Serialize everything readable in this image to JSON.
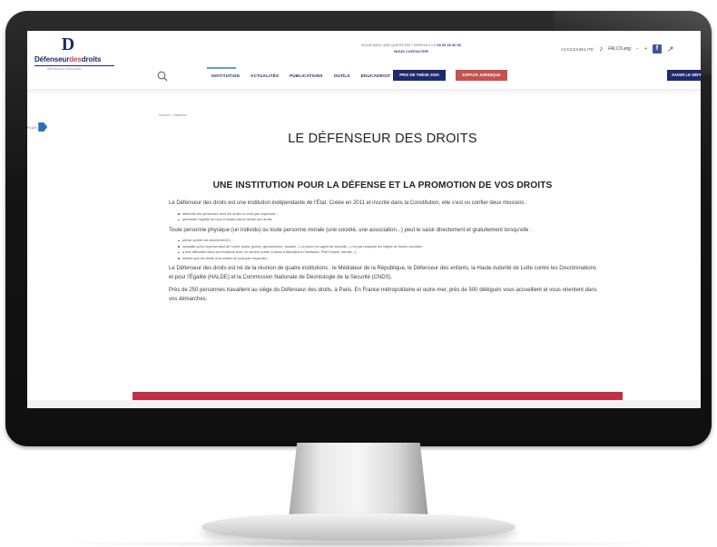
{
  "header": {
    "logo_letter": "D",
    "logo_part1": "Défenseur",
    "logo_part2": "des",
    "logo_part3": "droits",
    "logo_tagline": "RÉPUBLIQUE FRANÇAISE",
    "notice_line1": "VOUS AVEZ UNE QUESTION ? APPELEZ LE",
    "notice_number": "09 69 39 00 00",
    "notice_line2": "NOUS CONTACTER",
    "accessibility_label": "ACCESSIBILITÉ",
    "lang_label": "FALC/Lang",
    "facebook_glyph": "f"
  },
  "nav": {
    "items": [
      "INSTITUTION",
      "ACTUALITÉS",
      "PUBLICATIONS",
      "OUTILS",
      "EDUCADROIT"
    ],
    "prix_button": "PRIX DE THÈSE 2020",
    "espace_button": "ESPACE JURIDIQUE",
    "saisir_button": "SAISIR LE DÉFENSEUR"
  },
  "side_tab": {
    "label": "FLUX"
  },
  "main": {
    "breadcrumb": "Accueil > Institution",
    "page_title": "LE DÉFENSEUR DES DROITS",
    "section_title": "UNE INSTITUTION POUR LA DÉFENSE ET LA PROMOTION DE VOS DROITS",
    "p1": "Le Défenseur des droits est une institution indépendante de l'État. Créée en 2011 et inscrite dans la Constitution, elle s'est vu confier deux missions :",
    "bullets1": [
      "défendre les personnes dont les droits ne sont pas respectés ;",
      "permettre l'égalité de tous et toutes dans l'accès aux droits."
    ],
    "p2": "Toute personne physique (un individu) ou toute personne morale (une société, une association...) peut le saisir directement et gratuitement lorsqu'elle :",
    "bullet2_1_text": "pense qu'elle est discriminée",
    "bullet2_1_link": "(1)",
    "bullets2_rest": [
      "constate qu'un représentant de l'ordre public (police, gendarmerie, douane...) ou privé (un agent de sécurité...) n'a pas respecté les règles de bonne conduite ;",
      "a des difficultés dans ses relations avec un service public (Caisse d'Allocations Familiales, Pôle Emploi, retraite...) ;",
      "estime que les droits d'un enfant ne sont pas respectés ;"
    ],
    "p3": "Le Défenseur des droits est né de la réunion de quatre institutions : le Médiateur de la République, le Défenseur des enfants, la Haute Autorité de Lutte contre les Discriminations et pour l'Égalité (HALDE) et la Commission Nationale de Déontologie de la Sécurité (CNDS).",
    "p4": "Près de 250 personnes travaillent au siège du Défenseur des droits, à Paris. En France métropolitaine et outre-mer, près de 500 délégués vous accueillent et vous orientent dans vos démarches."
  },
  "colors": {
    "brand_navy": "#1b2b6b",
    "brand_red": "#c22e45",
    "link_blue": "#3a6fb5"
  }
}
